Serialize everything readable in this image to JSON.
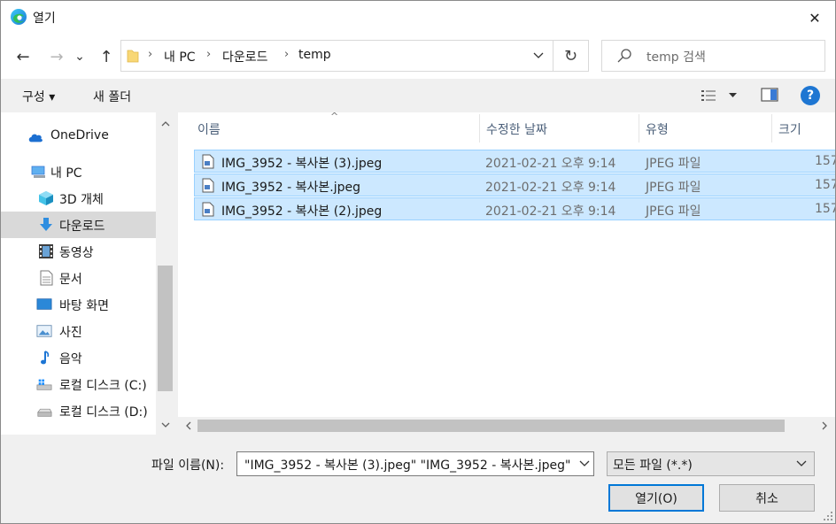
{
  "window": {
    "title": "열기",
    "close_glyph": "✕"
  },
  "nav": {
    "back_glyph": "←",
    "forward_glyph": "→",
    "recent_glyph": "⌄",
    "up_glyph": "↑",
    "breadcrumb": [
      "내 PC",
      "다운로드",
      "temp"
    ],
    "sep_glyph": "›",
    "refresh_glyph": "↻",
    "search_placeholder": "temp 검색"
  },
  "toolbar": {
    "organize_label": "구성 ▾",
    "new_folder_label": "새 폴더",
    "help_glyph": "?"
  },
  "sidebar": {
    "items": [
      {
        "label": "OneDrive",
        "icon": "cloud-icon"
      },
      {
        "label": "내 PC",
        "icon": "computer-icon"
      },
      {
        "label": "3D 개체",
        "icon": "cube-icon"
      },
      {
        "label": "다운로드",
        "icon": "download-icon",
        "selected": true
      },
      {
        "label": "동영상",
        "icon": "film-icon"
      },
      {
        "label": "문서",
        "icon": "document-icon"
      },
      {
        "label": "바탕 화면",
        "icon": "desktop-icon"
      },
      {
        "label": "사진",
        "icon": "picture-icon"
      },
      {
        "label": "음악",
        "icon": "music-icon"
      },
      {
        "label": "로컬 디스크 (C:)",
        "icon": "windows-drive-icon"
      },
      {
        "label": "로컬 디스크 (D:)",
        "icon": "drive-icon"
      }
    ]
  },
  "files": {
    "sort_glyph": "^",
    "columns": {
      "name": "이름",
      "date": "수정한 날짜",
      "type": "유형",
      "size": "크기"
    },
    "rows": [
      {
        "name": "IMG_3952 - 복사본 (3).jpeg",
        "date": "2021-02-21 오후 9:14",
        "type": "JPEG 파일",
        "size": "157"
      },
      {
        "name": "IMG_3952 - 복사본.jpeg",
        "date": "2021-02-21 오후 9:14",
        "type": "JPEG 파일",
        "size": "157"
      },
      {
        "name": "IMG_3952 - 복사본 (2).jpeg",
        "date": "2021-02-21 오후 9:14",
        "type": "JPEG 파일",
        "size": "157"
      }
    ]
  },
  "footer": {
    "filename_label": "파일 이름(N):",
    "filename_value": "\"IMG_3952 - 복사본 (3).jpeg\" \"IMG_3952 - 복사본.jpeg\"",
    "filetype_value": "모든 파일 (*.*)",
    "open_label": "열기(O)",
    "cancel_label": "취소"
  },
  "colors": {
    "selection": "#cce8ff",
    "accent": "#0078d7"
  }
}
